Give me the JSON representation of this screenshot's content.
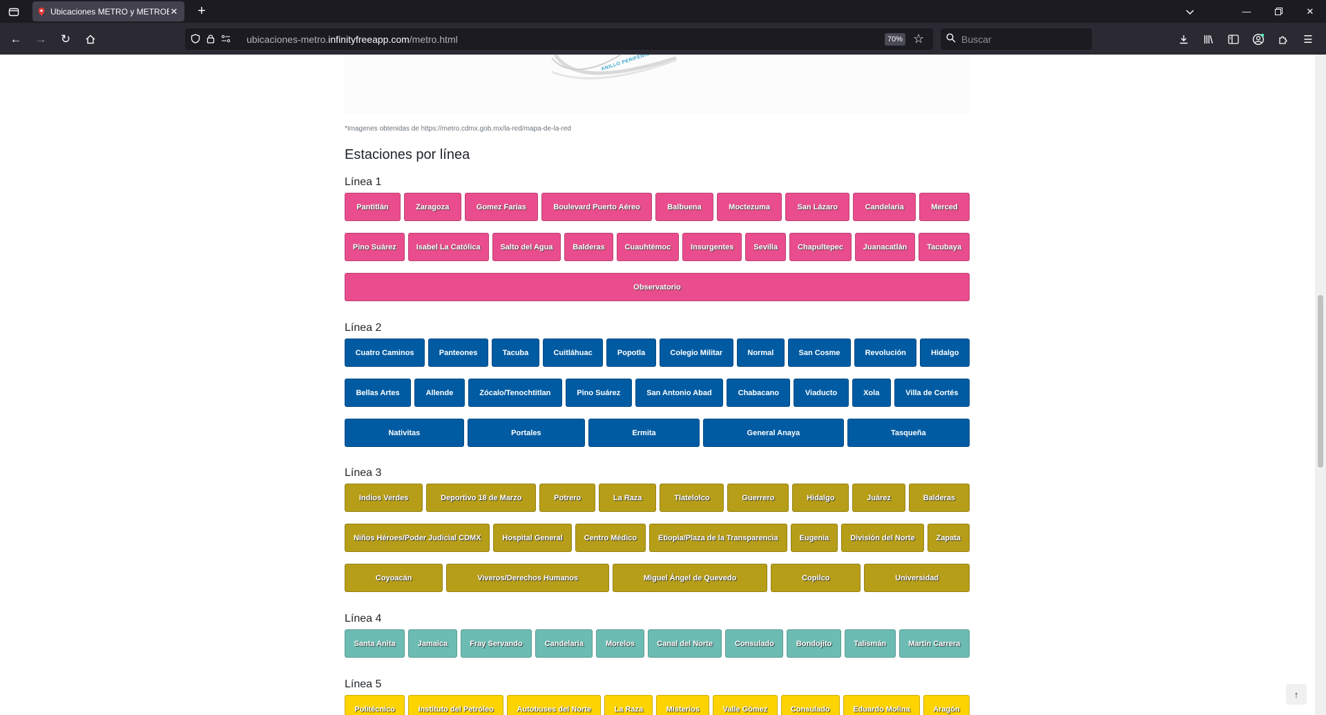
{
  "browser": {
    "tab_title": "Ubicaciones METRO y METROB",
    "url_prefix": "ubicaciones-metro.",
    "url_domain": "infinityfreeapp.com",
    "url_path": "/metro.html",
    "zoom": "70%",
    "search_placeholder": "Buscar"
  },
  "page": {
    "map_label": "ANILLO PERIFÉRICO",
    "credit": "*Imagenes obtenidas de https://metro.cdmx.gob.mx/la-red/mapa-de-la-red",
    "section_title": "Estaciones por línea"
  },
  "lines": [
    {
      "title": "Línea 1",
      "color": "#e94d8d",
      "rows": [
        [
          "Pantitlán",
          "Zaragoza",
          "Gomez Farías",
          "Boulevard Puerto Aéreo",
          "Balbuena",
          "Moctezuma",
          "San Lázaro",
          "Candelaria",
          "Merced"
        ],
        [
          "Pino Suárez",
          "Isabel La Católica",
          "Salto del Agua",
          "Balderas",
          "Cuauhtémoc",
          "Insurgentes",
          "Sevilla",
          "Chapultepec",
          "Juanacatlán",
          "Tacubaya"
        ],
        [
          "Observatorio"
        ]
      ]
    },
    {
      "title": "Línea 2",
      "color": "#005ba2",
      "rows": [
        [
          "Cuatro Caminos",
          "Panteones",
          "Tacuba",
          "Cuitláhuac",
          "Popotla",
          "Colegio Militar",
          "Normal",
          "San Cosme",
          "Revolución",
          "Hidalgo"
        ],
        [
          "Bellas Artes",
          "Allende",
          "Zócalo/Tenochtitlan",
          "Pino Suárez",
          "San Antonio Abad",
          "Chabacano",
          "Viaducto",
          "Xola",
          "Villa de Cortés"
        ],
        [
          "Nativitas",
          "Portales",
          "Ermita",
          "General Anaya",
          "Tasqueña"
        ]
      ]
    },
    {
      "title": "Línea 3",
      "color": "#b69e18",
      "rows": [
        [
          "Indios Verdes",
          "Deportivo 18 de Marzo",
          "Potrero",
          "La Raza",
          "Tlatelolco",
          "Guerrero",
          "Hidalgo",
          "Juárez",
          "Balderas"
        ],
        [
          "Niños Héroes/Poder Judicial CDMX",
          "Hospital General",
          "Centro Médico",
          "Etiopía/Plaza de la Transparencia",
          "Eugenia",
          "División del Norte",
          "Zapata"
        ],
        [
          "Coyoacán",
          "Viveros/Derechos Humanos",
          "Miguel Ángel de Quevedo",
          "Copilco",
          "Universidad"
        ]
      ]
    },
    {
      "title": "Línea 4",
      "color": "#6cbcb3",
      "rows": [
        [
          "Santa Anita",
          "Jamaica",
          "Fray Servando",
          "Candelaria",
          "Morelos",
          "Canal del Norte",
          "Consulado",
          "Bondojito",
          "Talismán",
          "Martín Carrera"
        ]
      ]
    },
    {
      "title": "Línea 5",
      "color": "#fdd300",
      "rows": [
        [
          "Politécnico",
          "Instituto del Petróleo",
          "Autobuses del Norte",
          "La Raza",
          "Misterios",
          "Valle Gómez",
          "Consulado",
          "Eduardo Molina",
          "Aragón"
        ]
      ]
    }
  ]
}
